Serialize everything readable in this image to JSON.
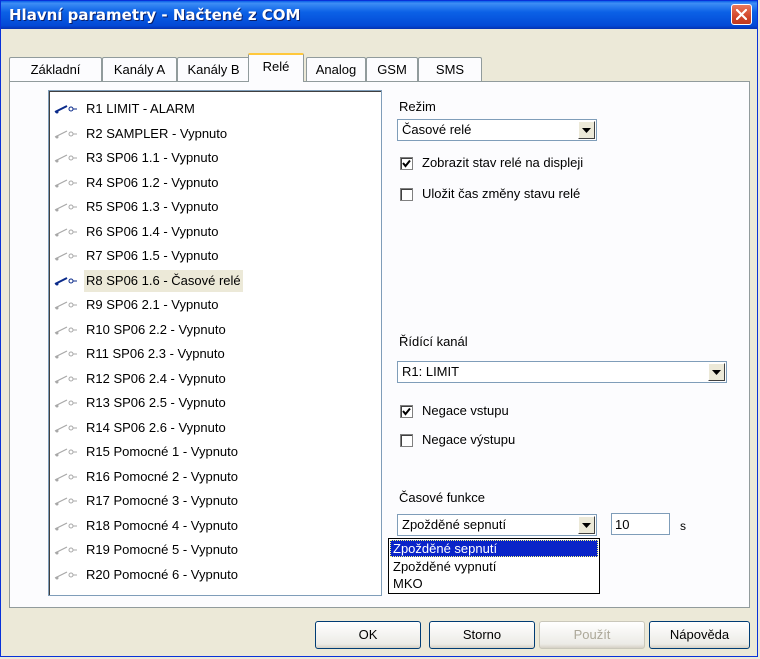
{
  "window": {
    "title": "Hlavní parametry - Načtené z COM"
  },
  "tabs": [
    {
      "label": "Základní"
    },
    {
      "label": "Kanály A"
    },
    {
      "label": "Kanály B"
    },
    {
      "label": "Relé",
      "active": true
    },
    {
      "label": "Analog"
    },
    {
      "label": "GSM"
    },
    {
      "label": "SMS"
    }
  ],
  "relays": [
    {
      "label": "R1 LIMIT - ALARM",
      "active": true
    },
    {
      "label": "R2 SAMPLER - Vypnuto"
    },
    {
      "label": "R3 SP06 1.1 - Vypnuto"
    },
    {
      "label": "R4 SP06 1.2 - Vypnuto"
    },
    {
      "label": "R5 SP06 1.3 - Vypnuto"
    },
    {
      "label": "R6 SP06 1.4 - Vypnuto"
    },
    {
      "label": "R7 SP06 1.5 - Vypnuto"
    },
    {
      "label": "R8 SP06 1.6 - Časové relé",
      "active": true,
      "selected": true
    },
    {
      "label": "R9 SP06 2.1 - Vypnuto"
    },
    {
      "label": "R10 SP06 2.2 - Vypnuto"
    },
    {
      "label": "R11 SP06 2.3 - Vypnuto"
    },
    {
      "label": "R12 SP06 2.4 - Vypnuto"
    },
    {
      "label": "R13 SP06 2.5 - Vypnuto"
    },
    {
      "label": "R14 SP06 2.6 - Vypnuto"
    },
    {
      "label": "R15 Pomocné 1 - Vypnuto"
    },
    {
      "label": "R16 Pomocné 2 - Vypnuto"
    },
    {
      "label": "R17 Pomocné 3 - Vypnuto"
    },
    {
      "label": "R18 Pomocné 4 - Vypnuto"
    },
    {
      "label": "R19 Pomocné 5 - Vypnuto"
    },
    {
      "label": "R20 Pomocné 6 - Vypnuto"
    }
  ],
  "mode": {
    "label": "Režim",
    "value": "Časové relé",
    "show_on_display": {
      "label": "Zobrazit stav relé na displeji",
      "checked": true
    },
    "save_change_time": {
      "label": "Uložit čas změny stavu relé",
      "checked": false
    }
  },
  "control_channel": {
    "label": "Řídící kanál",
    "value": "R1: LIMIT",
    "negate_input": {
      "label": "Negace vstupu",
      "checked": true
    },
    "negate_output": {
      "label": "Negace výstupu",
      "checked": false
    }
  },
  "time_function": {
    "label": "Časové funkce",
    "value": "Zpožděné sepnutí",
    "options": [
      "Zpožděné sepnutí",
      "Zpožděné vypnutí",
      "MKO"
    ],
    "time_value": "10",
    "unit": "s"
  },
  "buttons": {
    "ok": "OK",
    "cancel": "Storno",
    "apply": "Použít",
    "help": "Nápověda"
  }
}
